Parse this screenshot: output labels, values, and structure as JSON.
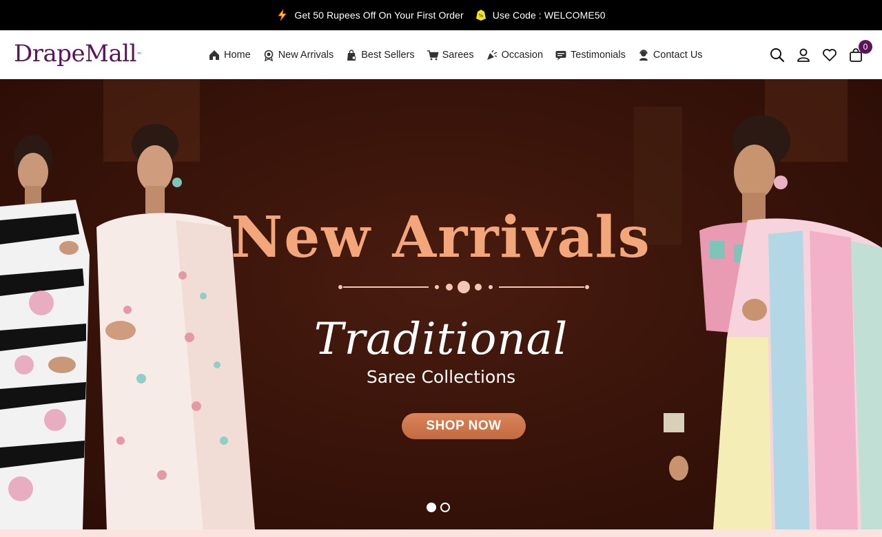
{
  "promo": {
    "offer_text": "Get 50 Rupees Off On Your First Order",
    "code_text": "Use Code : WELCOME50",
    "offer_icon": "lightning-icon",
    "code_icon": "coupon-tag-icon"
  },
  "brand": {
    "name": "DrapeMall",
    "mark": "™",
    "color": "#5c1459"
  },
  "nav": {
    "home": "Home",
    "new_arrivals": "New Arrivals",
    "best_sellers": "Best Sellers",
    "sarees": "Sarees",
    "occasion": "Occasion",
    "testimonials": "Testimonials",
    "contact_us": "Contact Us"
  },
  "header_icons": {
    "search": "search-icon",
    "account": "user-icon",
    "wishlist": "heart-icon",
    "cart": "shopping-bag-icon",
    "cart_count": "0"
  },
  "hero": {
    "title": "New Arrivals",
    "script": "Traditional",
    "subtitle": "Saree Collections",
    "cta": "SHOP NOW",
    "title_color": "#f3a67a",
    "cta_color": "#c97349",
    "slides_total": 2,
    "active_slide": 1
  }
}
